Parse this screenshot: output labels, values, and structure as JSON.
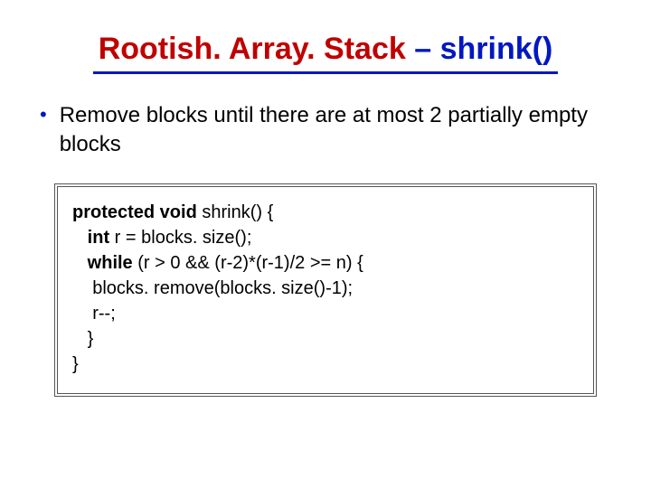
{
  "title": {
    "part1": "Rootish. Array. Stack",
    "sep": " – ",
    "part2": "shrink()"
  },
  "bullet": {
    "text": "Remove blocks until there are at most 2 partially empty blocks"
  },
  "code": {
    "l1_kw": "protected void ",
    "l1_rest": "shrink() {",
    "l2_indent": "   ",
    "l2_kw": "int ",
    "l2_rest": "r = blocks. size();",
    "l3_indent": "   ",
    "l3_kw": "while ",
    "l3_rest": "(r > 0 && (r-2)*(r-1)/2 >= n) {",
    "l4": "    blocks. remove(blocks. size()-1);",
    "l5": "    r--;",
    "l6": "   }",
    "l7": "}"
  }
}
